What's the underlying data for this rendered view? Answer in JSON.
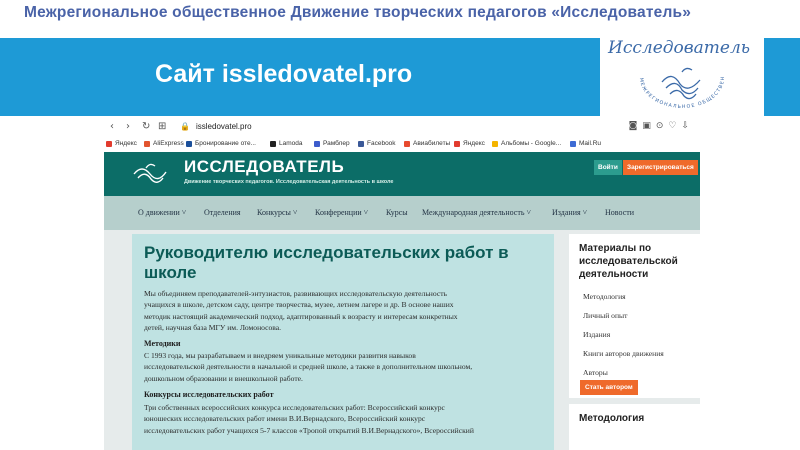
{
  "slide": {
    "organization": "Межрегиональное общественное Движение творческих педагогов «Исследователь»",
    "site_title": "Сайт issledovatel.pro",
    "logo_text": "Исследователь",
    "logo_ring_text": "МЕЖРЕГИОНАЛЬНОЕ ОБЩЕСТВЕННОЕ ДВИЖЕНИЕ",
    "colors": {
      "band": "#1e9ad6",
      "org_text": "#4a63a8"
    }
  },
  "browser": {
    "url": "issledovatel.pro",
    "bookmarks": [
      "Яндекс",
      "AliExpress",
      "Бронирование оте...",
      "Lamoda",
      "Рамблер",
      "Facebook",
      "Авиабилеты",
      "Яндекс",
      "Альбомы - Google...",
      "Mail.Ru"
    ]
  },
  "site": {
    "brand": "ИССЛЕДОВАТЕЛЬ",
    "tagline": "Движение творческих педагогов. Исследовательская деятельность в школе",
    "login_label": "Войти",
    "register_label": "Зарегистрироваться",
    "menu": [
      {
        "label": "О движении",
        "has_dropdown": true
      },
      {
        "label": "Отделения",
        "has_dropdown": false
      },
      {
        "label": "Конкурсы",
        "has_dropdown": true
      },
      {
        "label": "Конференции",
        "has_dropdown": true
      },
      {
        "label": "Курсы",
        "has_dropdown": false
      },
      {
        "label": "Международная деятельность",
        "has_dropdown": true
      },
      {
        "label": "Издания",
        "has_dropdown": true
      },
      {
        "label": "Новости",
        "has_dropdown": false
      }
    ],
    "colors": {
      "header": "#0c6d67",
      "accent": "#ef6a2b",
      "content_bg": "#bfe2e2"
    }
  },
  "article": {
    "title": "Руководителю исследовательских работ в школе",
    "intro": [
      "Мы объединяем преподавателей-энтузиастов, развивающих исследовательскую деятельность",
      "учащихся в школе, детском саду, центре творчества, музее, летнем лагере и др. В основе наших",
      "методик настоящий академический подход, адаптированный к возрасту и интересам конкретных",
      "детей, научная база МГУ им. Ломоносова."
    ],
    "methods_heading": "Методики",
    "methods": [
      "С 1993 года, мы разрабатываем и внедряем уникальные методики развития навыков",
      "исследовательской деятельности в начальной и средней школе, а также в дополнительном школьном,",
      "дошкольном образовании и внешкольной работе."
    ],
    "contests_heading": "Конкурсы исследовательских работ",
    "contests": [
      "Три собственных всероссийских конкурса исследовательских работ: Всероссийский конкурс",
      "юношеских исследовательских работ имени В.И.Вернадского, Всероссийский конкурс",
      "исследовательских работ учащихся 5-7 классов «Тропой открытий В.И.Вернадского», Всероссийский"
    ]
  },
  "sidebar": {
    "title": "Материалы по исследовательской деятельности",
    "links": [
      "Методология",
      "Личный опыт",
      "Издания",
      "Книги авторов движения",
      "Авторы"
    ],
    "author_button": "Стать автором",
    "second_title": "Методология"
  }
}
